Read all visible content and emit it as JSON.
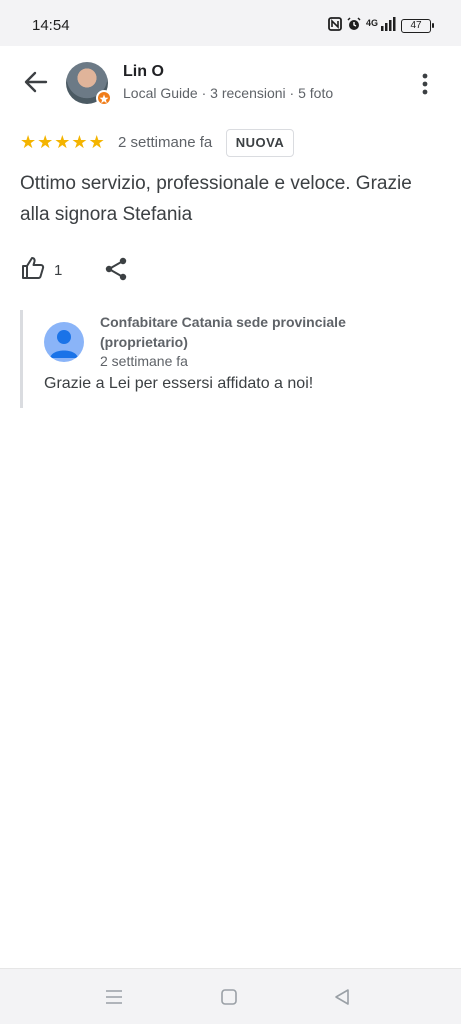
{
  "status_bar": {
    "time": "14:54",
    "network": "4G",
    "battery": "47",
    "icons": [
      "nfc-icon",
      "alarm-icon",
      "signal-icon",
      "battery-icon"
    ]
  },
  "header": {
    "user_name": "Lin O",
    "user_meta": "Local Guide · 3 recensioni · 5 foto",
    "icons": [
      "back-arrow-icon",
      "more-vert-icon"
    ]
  },
  "review": {
    "rating": 5,
    "stars": [
      "★",
      "★",
      "★",
      "★",
      "★"
    ],
    "time": "2 settimane fa",
    "badge": "NUOVA",
    "text": "Ottimo servizio, professionale e veloce. Grazie alla signora Stefania",
    "likes": "1",
    "star_color": "#f4b400"
  },
  "owner_reply": {
    "name": "Confabitare Catania sede provinciale (proprietario)",
    "time": "2 settimane fa",
    "text": "Grazie a Lei per essersi affidato a noi!"
  },
  "nav_bar": {
    "icons": [
      "menu-icon",
      "home-icon",
      "back-icon"
    ]
  }
}
